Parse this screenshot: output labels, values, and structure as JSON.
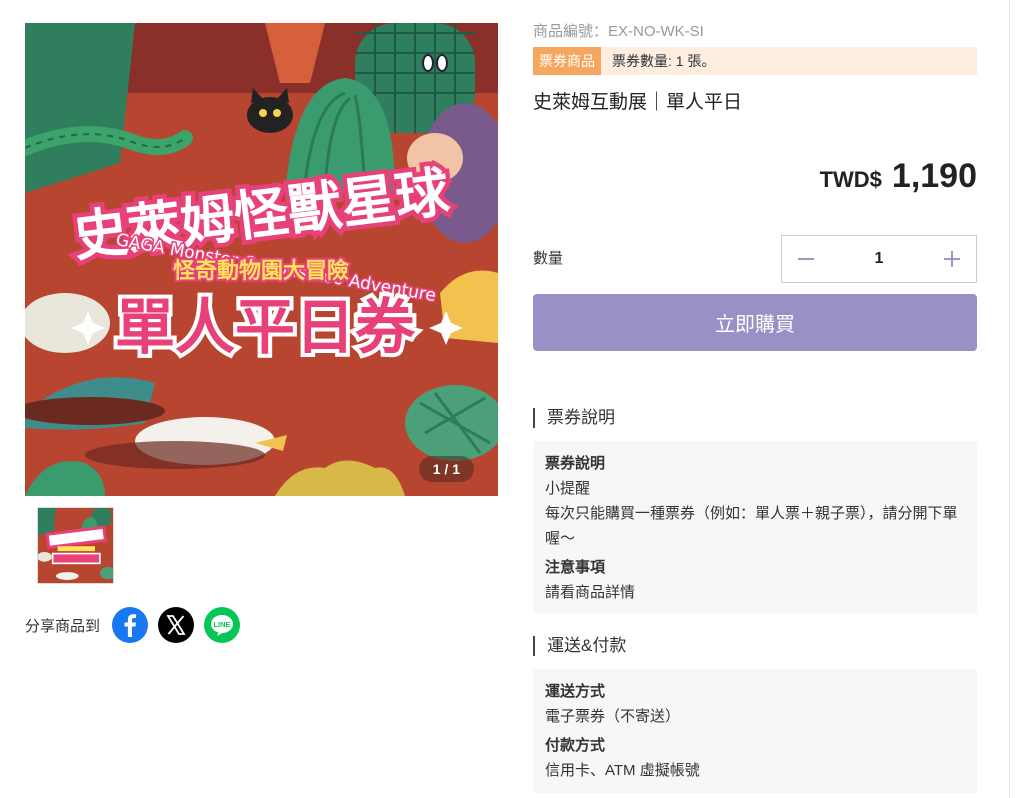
{
  "gallery": {
    "banner": {
      "title_cn": "史萊姆怪獸星球",
      "title_en": "GAGA Monster:Curious Zoo Adventure",
      "subtitle": "怪奇動物園大冒險",
      "ticket_type": "單人平日券"
    },
    "counter": "1 / 1"
  },
  "share": {
    "label": "分享商品到",
    "icons": [
      "facebook-icon",
      "x-icon",
      "line-icon"
    ],
    "line_text": "LINE"
  },
  "product": {
    "sku": "商品編號：EX-NO-WK-SI",
    "badge": "票券商品",
    "ticket_count": "票券數量: 1 張。",
    "title": "史萊姆互動展｜單人平日",
    "currency": "TWD$",
    "price": "1,190",
    "quantity_label": "數量",
    "quantity": "1",
    "buy_label": "立即購買"
  },
  "ticket_section": {
    "heading": "票券說明",
    "lines": [
      {
        "text": "票券說明",
        "bold": true
      },
      {
        "text": "小提醒",
        "bold": false
      },
      {
        "text": "每次只能購買一種票券（例如：單人票＋親子票），請分開下單喔～",
        "bold": false
      },
      {
        "text": "注意事項",
        "bold": true
      },
      {
        "text": "請看商品詳情",
        "bold": false
      }
    ]
  },
  "shipping_section": {
    "heading": "運送&付款",
    "lines": [
      {
        "text": "運送方式",
        "bold": true
      },
      {
        "text": "電子票券（不寄送）",
        "bold": false
      },
      {
        "text": "付款方式",
        "bold": true
      },
      {
        "text": "信用卡、ATM 虛擬帳號",
        "bold": false
      }
    ]
  },
  "colors": {
    "accent_purple": "#9a90c6",
    "badge_orange": "#f5a75f",
    "badge_bg": "#fdeee0",
    "banner_pink": "#e8417a",
    "banner_green": "#1fa56a"
  }
}
